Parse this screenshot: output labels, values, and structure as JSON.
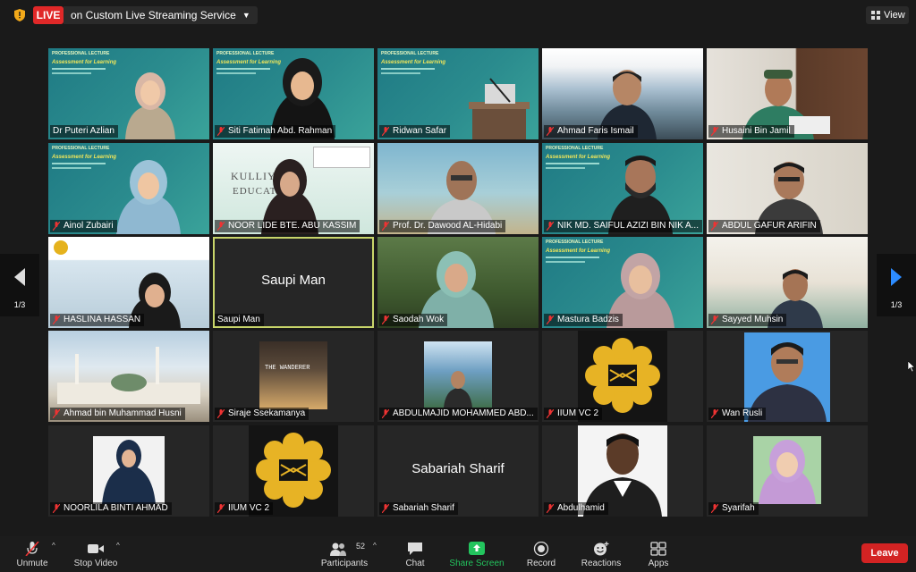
{
  "topbar": {
    "live_label": "LIVE",
    "stream_label": "on Custom Live Streaming Service",
    "view_label": "View",
    "icons": [
      "shield-icon",
      "chevron-down-icon",
      "grid-view-icon"
    ]
  },
  "pagination": {
    "left_page": "1/3",
    "right_page": "1/3"
  },
  "participants": [
    {
      "name": "Dr Puteri Azlian"
    },
    {
      "name": "Siti Fatimah Abd. Rahman"
    },
    {
      "name": "Ridwan Safar"
    },
    {
      "name": "Ahmad Faris Ismail"
    },
    {
      "name": "Husaini Bin Jamil"
    },
    {
      "name": "Ainol Zubairi"
    },
    {
      "name": "NOOR LIDE BTE. ABU KASSIM"
    },
    {
      "name": "Prof. Dr. Dawood AL-Hidabi"
    },
    {
      "name": "NIK MD. SAIFUL AZIZI BIN NIK A..."
    },
    {
      "name": "ABDUL GAFUR ARIFIN"
    },
    {
      "name": "HASLINA HASSAN"
    },
    {
      "name": "Saupi Man",
      "display_name": "Saupi Man"
    },
    {
      "name": "Saodah Wok"
    },
    {
      "name": "Mastura Badzis"
    },
    {
      "name": "Sayyed Muhsin"
    },
    {
      "name": "Ahmad bin Muhammad Husni"
    },
    {
      "name": "Siraje Ssekamanya"
    },
    {
      "name": "ABDULMAJID MOHAMMED ABD..."
    },
    {
      "name": "IIUM VC 2"
    },
    {
      "name": "Wan Rusli"
    },
    {
      "name": "NOORLILA BINTI AHMAD"
    },
    {
      "name": "IIUM VC 2"
    },
    {
      "name": "Sabariah Sharif",
      "display_name": "Sabariah Sharif"
    },
    {
      "name": "Abdulhamid"
    },
    {
      "name": "Syarifah"
    }
  ],
  "tile_text": {
    "professional_lecture": "PROFESSIONAL LECTURE",
    "assessment": "Assessment for Learning",
    "kulliyyah": "KULLIYYA",
    "educa": "EDUCATI",
    "wanderer": "THE WANDERER"
  },
  "toolbar": {
    "unmute": "Unmute",
    "stop_video": "Stop Video",
    "participants": "Participants",
    "participants_count": "52",
    "chat": "Chat",
    "share_screen": "Share Screen",
    "record": "Record",
    "reactions": "Reactions",
    "apps": "Apps",
    "leave": "Leave"
  },
  "colors": {
    "live_red": "#e02828",
    "share_green": "#23c55e",
    "leave_red": "#d32323",
    "active_speaker": "#c8d56a",
    "nav_arrow": "#2d8cff"
  }
}
